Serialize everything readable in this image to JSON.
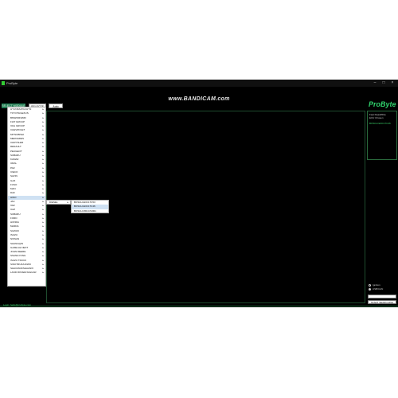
{
  "window": {
    "title": "ProByte",
    "minimize": "–",
    "maximize": "□",
    "close": "×"
  },
  "watermark": "www.BANDICAM.com",
  "toolbar": {
    "brand_tab": "SELECT MODULE",
    "tab_two": "SELECTE",
    "tab_three": "Auto Detect"
  },
  "logo": "ProByte",
  "right_panel": {
    "lines": [
      "Fast ReadWrite",
      "ECU Chosen",
      "BOSCH EDC17C46"
    ]
  },
  "brands": [
    "HYUNDAI/KIA/HYN",
    "TOYOTA/LEXUS",
    "BMW/MINI/RR",
    "FIAT GROUP",
    "VAG GROUP",
    "CHEVROLET",
    "MITSUBISHI",
    "MERCEDES",
    "CHRYSLER",
    "RENAULT",
    "PEUGEOT",
    "SUBARU",
    "KAMAZ",
    "URAL",
    "PAZ",
    "IVECO",
    "SAVIN",
    "GAZ",
    "FUSO",
    "MAN",
    "DAF",
    "HINO",
    "JAC",
    "VAZ",
    "UAZ",
    "SUBARU",
    "FORD",
    "HONDA",
    "MAZDA",
    "SUZUKI",
    "ISUZU",
    "NISSAN",
    "SHANGQIN",
    "GAZELLE NEXT",
    "JOHN DEERE",
    "SSANGYONG",
    "ISUZU TRUCK",
    "SINOTRUK/HOWO",
    "SHACMAN/SHAANXI",
    "LAND ROVER/JAGUAR"
  ],
  "highlighted_brand_index": 21,
  "submenu_fuel": [
    "DIESEL"
  ],
  "submenu_ecus": [
    "BOSCH EDC17C53",
    "BOSCH EDC17C46",
    "BOSCH MD1CS/001"
  ],
  "highlighted_ecu_index": 1,
  "radio_options": [
    {
      "label": "Ignition",
      "checked": false
    },
    {
      "label": "USB/CAN",
      "checked": true
    }
  ],
  "action_button": "START SEARCHING",
  "status": "Login: hello@probyte.com"
}
